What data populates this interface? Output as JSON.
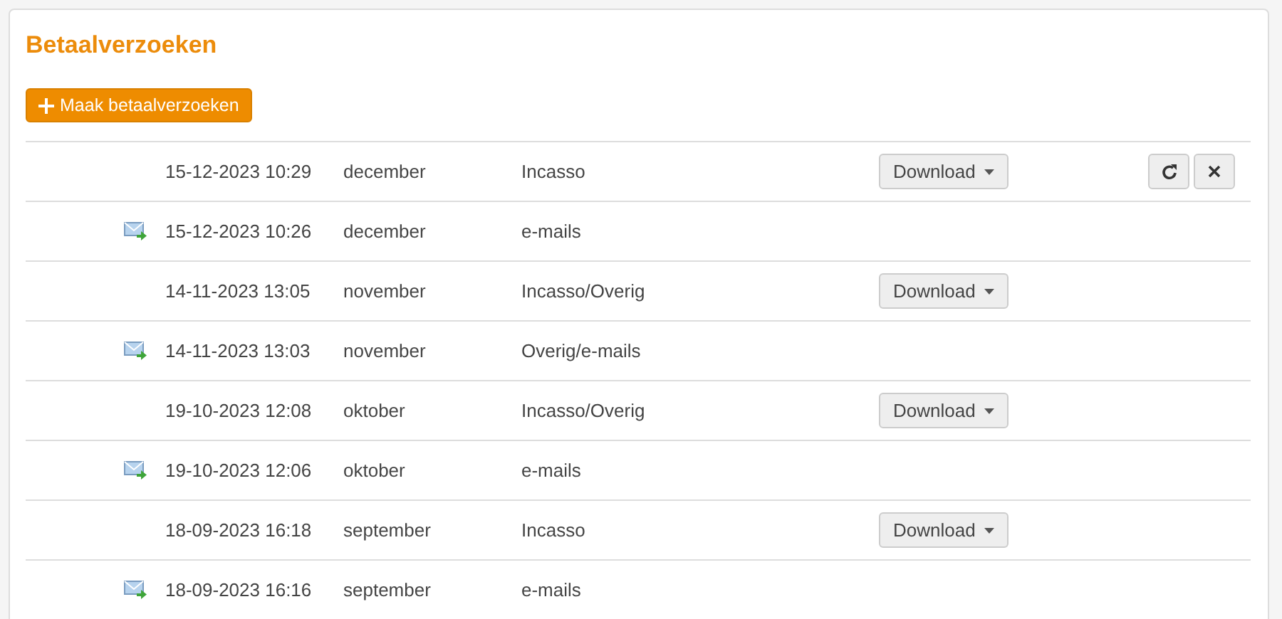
{
  "title": "Betaalverzoeken",
  "create_button": {
    "label": "Maak betaalverzoeken"
  },
  "rows": [
    {
      "kind": "download",
      "date": "15-12-2023 10:29",
      "month": "december",
      "type": "Incasso",
      "download_label": "Download",
      "actions_shown": true
    },
    {
      "kind": "mail",
      "date": "15-12-2023 10:26",
      "month": "december",
      "type": "e-mails",
      "actions_shown": false
    },
    {
      "kind": "download",
      "date": "14-11-2023 13:05",
      "month": "november",
      "type": "Incasso/Overig",
      "download_label": "Download",
      "actions_shown": false
    },
    {
      "kind": "mail",
      "date": "14-11-2023 13:03",
      "month": "november",
      "type": "Overig/e-mails",
      "actions_shown": false
    },
    {
      "kind": "download",
      "date": "19-10-2023 12:08",
      "month": "oktober",
      "type": "Incasso/Overig",
      "download_label": "Download",
      "actions_shown": false
    },
    {
      "kind": "mail",
      "date": "19-10-2023 12:06",
      "month": "oktober",
      "type": "e-mails",
      "actions_shown": false
    },
    {
      "kind": "download",
      "date": "18-09-2023 16:18",
      "month": "september",
      "type": "Incasso",
      "download_label": "Download",
      "actions_shown": false
    },
    {
      "kind": "mail",
      "date": "18-09-2023 16:16",
      "month": "september",
      "type": "e-mails",
      "actions_shown": false
    }
  ]
}
